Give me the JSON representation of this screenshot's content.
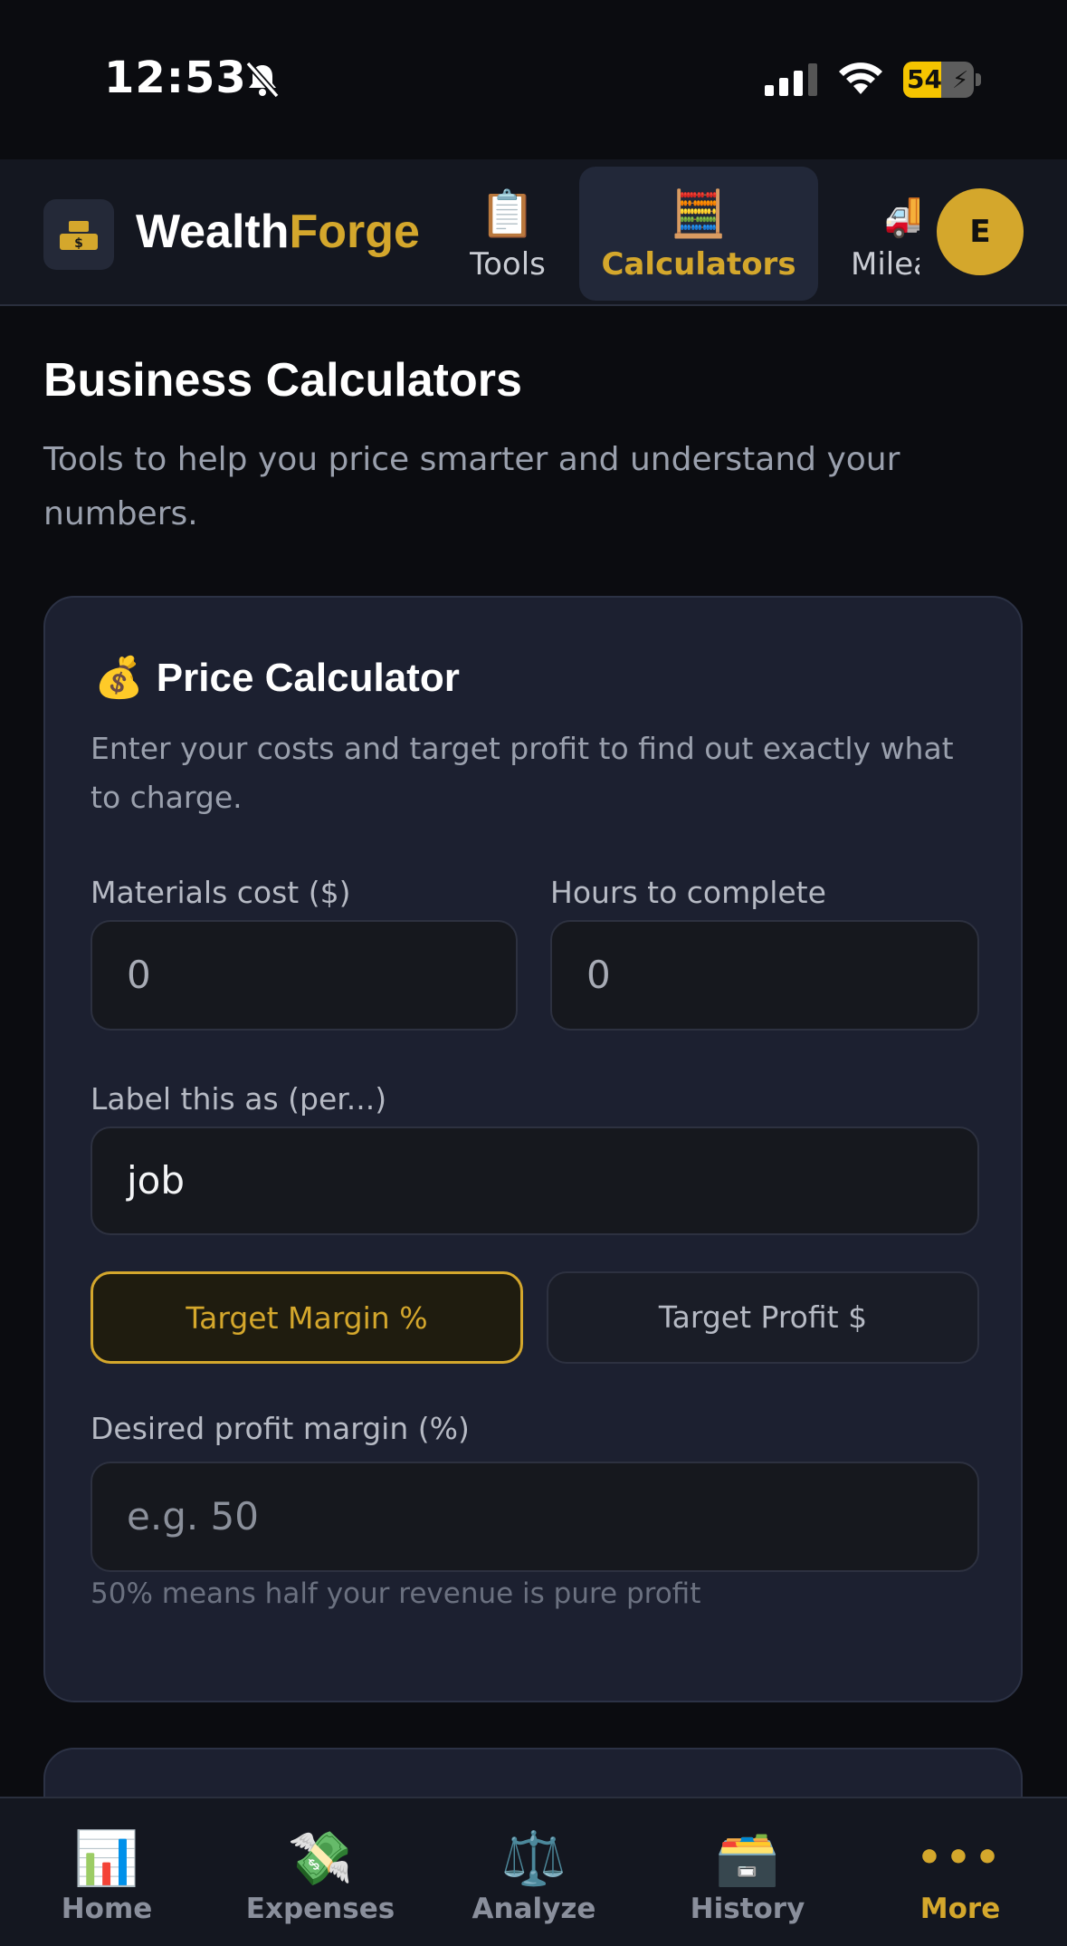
{
  "status_bar": {
    "time": "12:53",
    "battery": "54",
    "battery_level": 0.54
  },
  "header": {
    "brand_part1": "Wealth",
    "brand_part2": "Forge",
    "avatar_initial": "E",
    "tabs": [
      {
        "label": "Tools",
        "icon": "clipboard-icon",
        "emoji": "📋",
        "active": false
      },
      {
        "label": "Calculators",
        "icon": "abacus-icon",
        "emoji": "🧮",
        "active": true
      },
      {
        "label": "Milea",
        "icon": "truck-icon",
        "emoji": "🚚",
        "active": false
      }
    ]
  },
  "page": {
    "title": "Business Calculators",
    "subtitle": "Tools to help you price smarter and understand your numbers."
  },
  "price_calculator": {
    "icon_emoji": "💰",
    "title": "Price Calculator",
    "description": "Enter your costs and target profit to find out exactly what to charge.",
    "materials_label": "Materials cost ($)",
    "materials_value": "0",
    "hours_label": "Hours to complete",
    "hours_value": "0",
    "per_label": "Label this as (per...)",
    "per_value": "job",
    "mode_margin": "Target Margin %",
    "mode_profit": "Target Profit $",
    "active_mode": "Target Margin %",
    "margin_label": "Desired profit margin (%)",
    "margin_placeholder": "e.g. 50",
    "margin_hint": "50% means half your revenue is pure profit"
  },
  "bottom_nav": {
    "items": [
      {
        "label": "Home",
        "emoji": "📊",
        "icon": "bar-chart-icon"
      },
      {
        "label": "Expenses",
        "emoji": "💸",
        "icon": "money-wings-icon"
      },
      {
        "label": "Analyze",
        "emoji": "⚖️",
        "icon": "scales-icon"
      },
      {
        "label": "History",
        "emoji": "🗃️",
        "icon": "card-file-box-icon"
      },
      {
        "label": "More",
        "symbol": "•••",
        "icon": "more-dots-icon",
        "active": true
      }
    ]
  },
  "colors": {
    "accent": "#d4a72c",
    "background": "#0b0c10",
    "card": "#1c2030"
  }
}
